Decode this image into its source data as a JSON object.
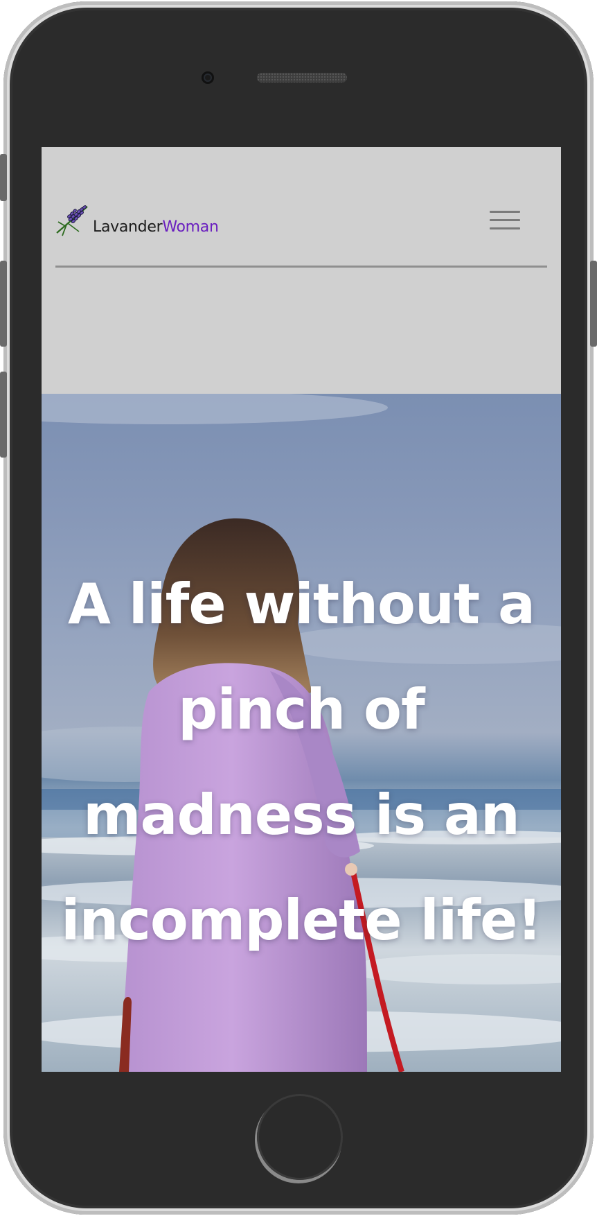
{
  "site": {
    "logo": {
      "icon": "lavender-sprig-icon",
      "text_part1": "Lavander",
      "text_part2": "Woman",
      "colors": {
        "part1": "#1c1c1c",
        "part2": "#6a1fbf"
      }
    },
    "menu": {
      "icon": "hamburger-menu-icon"
    }
  },
  "hero": {
    "quote": "A life without a pinch of madness is an incomplete life!",
    "image": "woman-in-lavender-coat-at-sea"
  },
  "device": {
    "type": "smartphone-mockup",
    "home_button_icon": "home-button-icon"
  },
  "colors": {
    "header_bg": "#d0d0d0",
    "divider": "#8f8f8f",
    "hero_text": "#ffffff",
    "device_body": "#2b2b2b"
  }
}
